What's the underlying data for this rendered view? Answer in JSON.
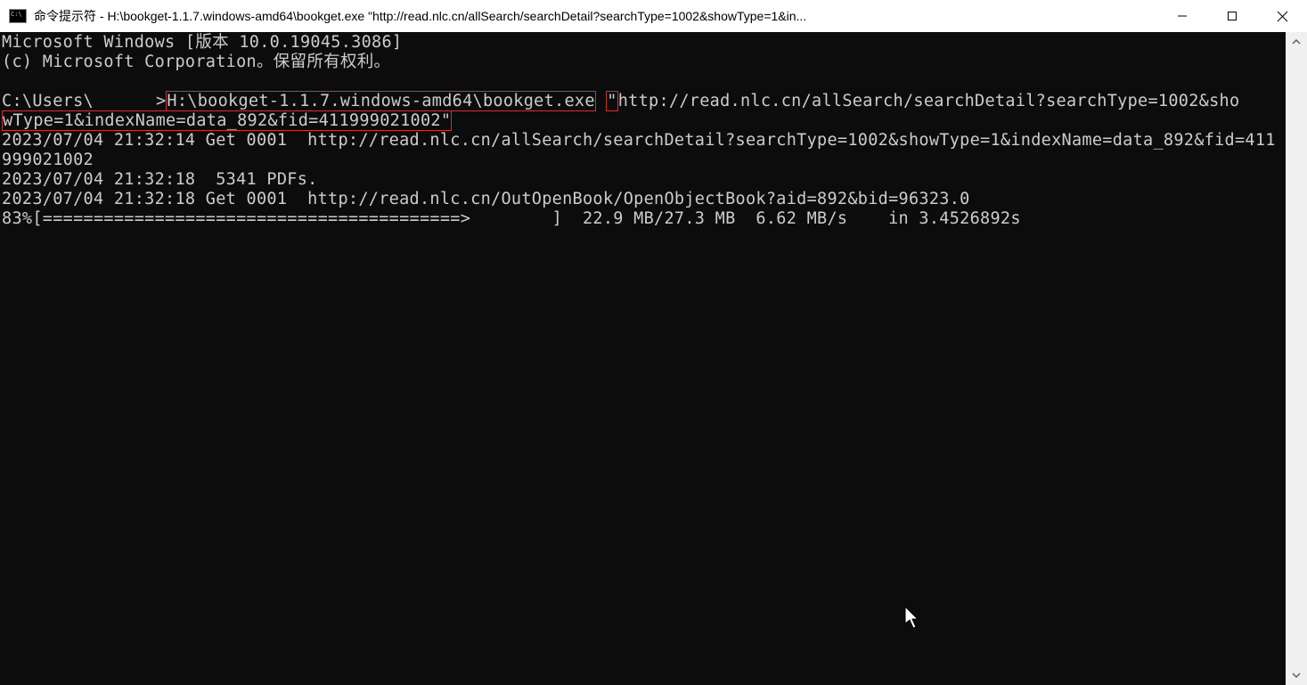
{
  "titlebar": {
    "title": "命令提示符 - H:\\bookget-1.1.7.windows-amd64\\bookget.exe  \"http://read.nlc.cn/allSearch/searchDetail?searchType=1002&showType=1&in..."
  },
  "terminal": {
    "line1": "Microsoft Windows [版本 10.0.19045.3086]",
    "line2": "(c) Microsoft Corporation。保留所有权利。",
    "blank1": "",
    "prompt_prefix": "C:\\Users\\",
    "prompt_suffix": ">",
    "cmd_exe": "H:\\bookget-1.1.7.windows-amd64\\bookget.exe",
    "quote1": "\"",
    "cmd_url_part1": "http://read.nlc.cn/allSearch/searchDetail?searchType=1002&sho",
    "cmd_url_part2": "wType=1&indexName=data_892&fid=411999021002",
    "quote2": "\"",
    "log1": "2023/07/04 21:32:14 Get 0001  http://read.nlc.cn/allSearch/searchDetail?searchType=1002&showType=1&indexName=data_892&fid=411999021002",
    "log2": "2023/07/04 21:32:18  5341 PDFs.",
    "log3": "2023/07/04 21:32:18 Get 0001  http://read.nlc.cn/OutOpenBook/OpenObjectBook?aid=892&bid=96323.0",
    "progress": "83%[=========================================>        ]  22.9 MB/27.3 MB  6.62 MB/s    in 3.4526892s"
  }
}
